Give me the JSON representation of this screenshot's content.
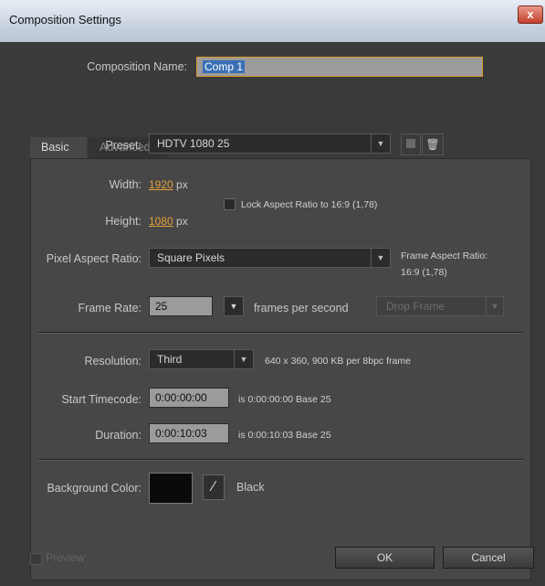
{
  "window": {
    "title": "Composition Settings",
    "close_icon": "close-icon",
    "close_glyph": "x"
  },
  "comp_name": {
    "label": "Composition Name:",
    "value": "Comp 1"
  },
  "tabs": [
    {
      "label": "Basic",
      "active": true
    },
    {
      "label": "Advanced",
      "active": false
    }
  ],
  "preset": {
    "label": "Preset:",
    "value": "HDTV 1080 25"
  },
  "width": {
    "label": "Width:",
    "value": "1920",
    "unit": "px"
  },
  "height": {
    "label": "Height:",
    "value": "1080",
    "unit": "px"
  },
  "lock_aspect": {
    "label": "Lock Aspect Ratio to 16:9 (1,78)",
    "checked": false
  },
  "pixel_aspect": {
    "label": "Pixel Aspect Ratio:",
    "value": "Square Pixels"
  },
  "frame_aspect": {
    "label": "Frame Aspect Ratio:",
    "value": "16:9 (1,78)"
  },
  "frame_rate": {
    "label": "Frame Rate:",
    "value": "25",
    "unit": "frames per second",
    "drop_frame": "Drop Frame"
  },
  "resolution": {
    "label": "Resolution:",
    "value": "Third",
    "info": "640 x 360, 900 KB per 8bpc frame"
  },
  "start_timecode": {
    "label": "Start Timecode:",
    "value": "0:00:00:00",
    "info": "is 0:00:00:00  Base 25"
  },
  "duration": {
    "label": "Duration:",
    "value": "0:00:10:03",
    "info": "is 0:00:10:03  Base 25"
  },
  "background": {
    "label": "Background Color:",
    "color_name": "Black",
    "swatch": "#0a0a0a"
  },
  "footer": {
    "preview_label": "Preview",
    "ok_label": "OK",
    "cancel_label": "Cancel"
  },
  "colors": {
    "accent_orange": "#e3a03a",
    "field_gray": "#9b9b9b",
    "panel": "#474747"
  }
}
